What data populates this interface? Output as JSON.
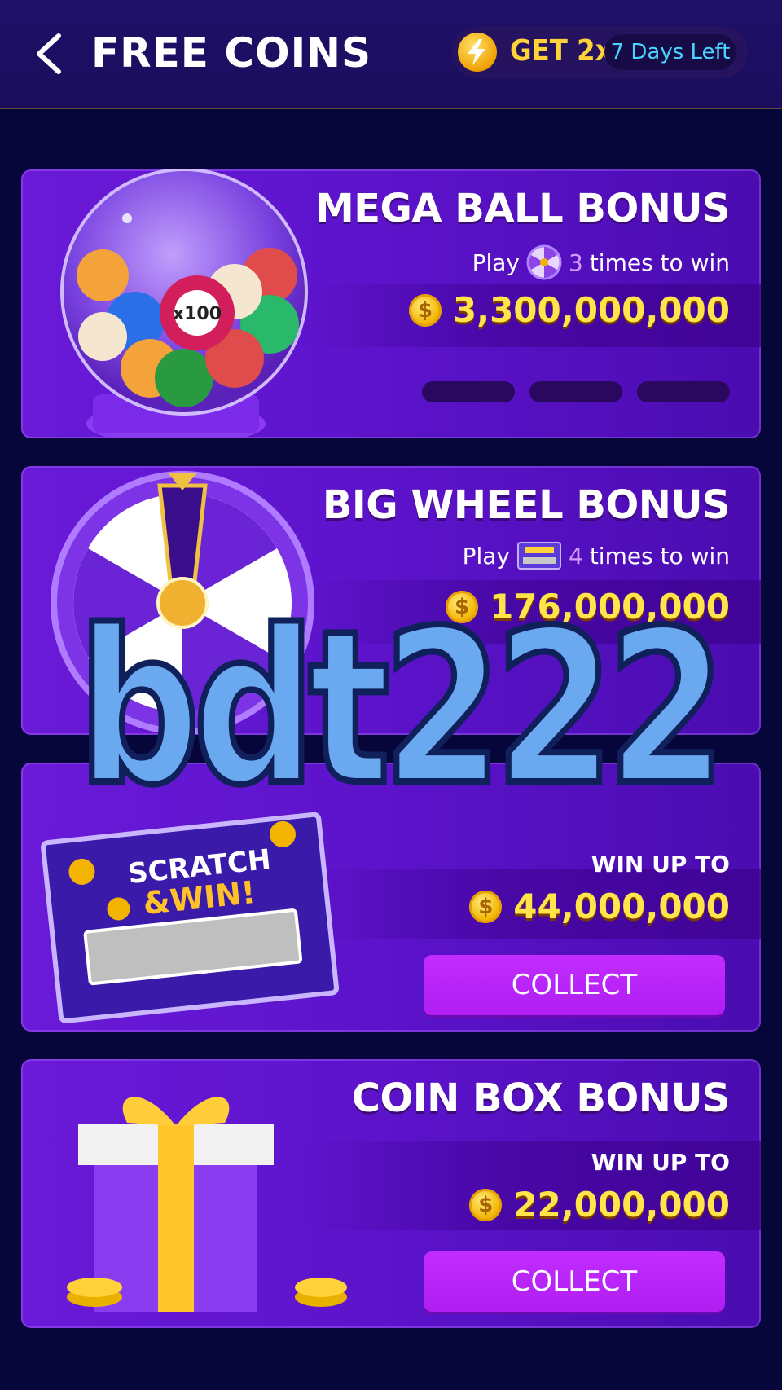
{
  "header": {
    "title": "FREE COINS",
    "boost_label": "GET 2x",
    "days_left": "7 Days Left"
  },
  "cards": [
    {
      "title": "MEGA BALL BONUS",
      "play_prefix": "Play",
      "count": "3",
      "play_suffix": "times to win",
      "amount": "3,300,000,000",
      "progress_filled": 0,
      "progress_total": 3
    },
    {
      "title": "BIG WHEEL BONUS",
      "play_prefix": "Play",
      "count": "4",
      "play_suffix": "times to win",
      "amount": "176,000,000"
    },
    {
      "subtitle": "WIN UP TO",
      "amount": "44,000,000",
      "button": "COLLECT",
      "art_text_1": "SCRATCH",
      "art_text_2": "&WIN!"
    },
    {
      "title": "COIN BOX BONUS",
      "subtitle": "WIN UP TO",
      "amount": "22,000,000",
      "button": "COLLECT"
    }
  ],
  "watermark": "bdt222",
  "colors": {
    "background": "#06063a",
    "card": "#5a12c8",
    "gold": "#ffe54a",
    "collect": "#c22cff",
    "days_left_text": "#4ad4ff"
  }
}
